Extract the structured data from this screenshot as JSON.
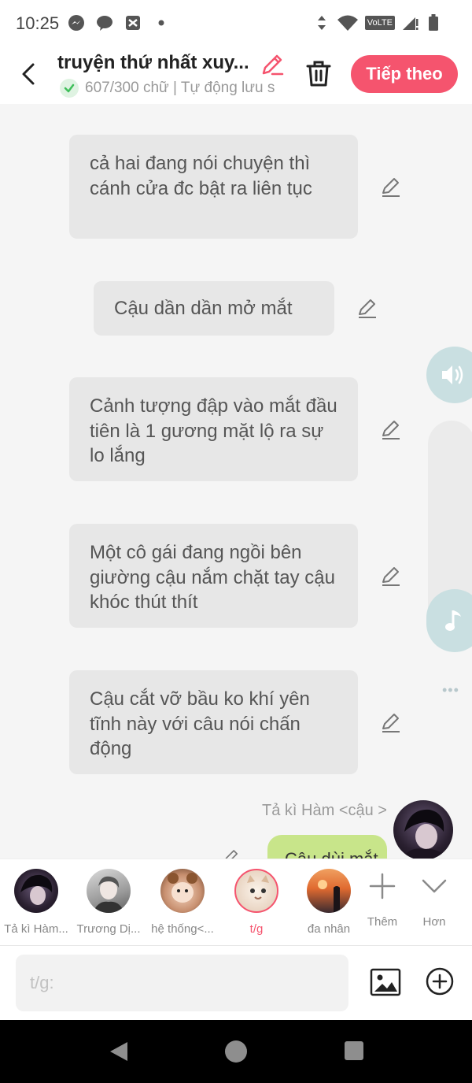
{
  "status_bar": {
    "time": "10:25",
    "network_label": "VoLTE"
  },
  "header": {
    "title": "truyện thứ nhất xuy...",
    "status": "607/300 chữ | Tự động lưu s",
    "next_label": "Tiếp theo"
  },
  "messages": [
    {
      "text": "cả hai đang nói chuyện thì cánh cửa đc bật ra liên tục"
    },
    {
      "text": "Cậu dần dần mở mắt"
    },
    {
      "text": "Cảnh tượng  đập vào mắt đầu tiên là 1 gương mặt lộ ra sự lo lắng"
    },
    {
      "text": "Một cô gái đang ngồi bên giường cậu nắm chặt tay cậu khóc thút thít"
    },
    {
      "text": "Cậu cắt vỡ bầu ko khí yên tĩnh này với câu nói chấn động"
    }
  ],
  "current_speaker": {
    "name": "Tả kì Hàm <cậu >",
    "partial_text": "Câu dùi mắt"
  },
  "side_more": "•••",
  "characters": [
    {
      "name": "Tả kì Hàm...",
      "active": false
    },
    {
      "name": "Trương Dị...",
      "active": false
    },
    {
      "name": "hệ thống<...",
      "active": false
    },
    {
      "name": "t/g",
      "active": true
    },
    {
      "name": "đa nhân",
      "active": false
    }
  ],
  "tools": {
    "add_label": "Thêm",
    "more_label": "Hơn"
  },
  "input": {
    "placeholder": "t/g:"
  },
  "colors": {
    "accent": "#f5546e",
    "bubble": "#e7e7e7",
    "player_bubble": "#c8e58a",
    "side_button": "#c9dfe1"
  }
}
